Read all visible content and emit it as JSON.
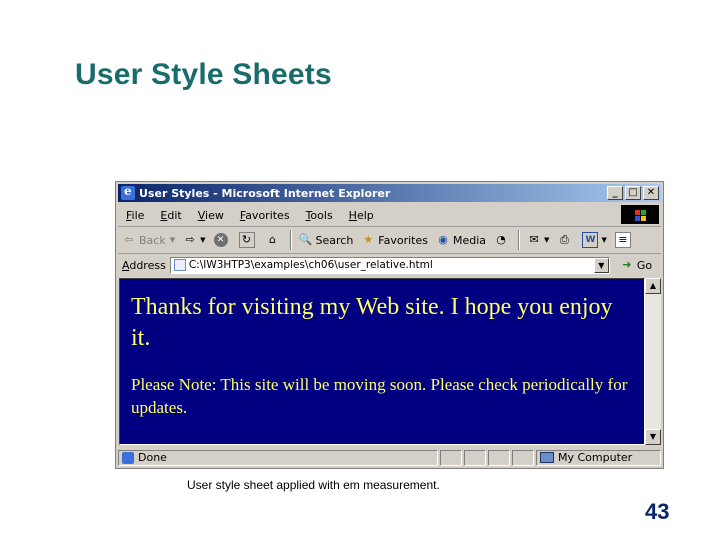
{
  "slide": {
    "title": "User Style Sheets",
    "caption": "User style sheet applied with em measurement.",
    "page_number": "43",
    "title_color": "#1a6b6b"
  },
  "window": {
    "title": "User Styles - Microsoft Internet Explorer",
    "menu": [
      "File",
      "Edit",
      "View",
      "Favorites",
      "Tools",
      "Help"
    ],
    "toolbar": {
      "back": "Back",
      "search": "Search",
      "favorites": "Favorites",
      "media": "Media"
    },
    "address": {
      "label": "Address",
      "value": "C:\\IW3HTP3\\examples\\ch06\\user_relative.html",
      "go": "Go"
    },
    "content": {
      "background": "#000080",
      "text_color": "#ffff66",
      "large_text": "Thanks for visiting my Web site. I hope you enjoy it.",
      "small_text": "Please Note: This site will be moving soon. Please check periodically for updates."
    },
    "status": {
      "left": "Done",
      "zone": "My Computer"
    }
  }
}
